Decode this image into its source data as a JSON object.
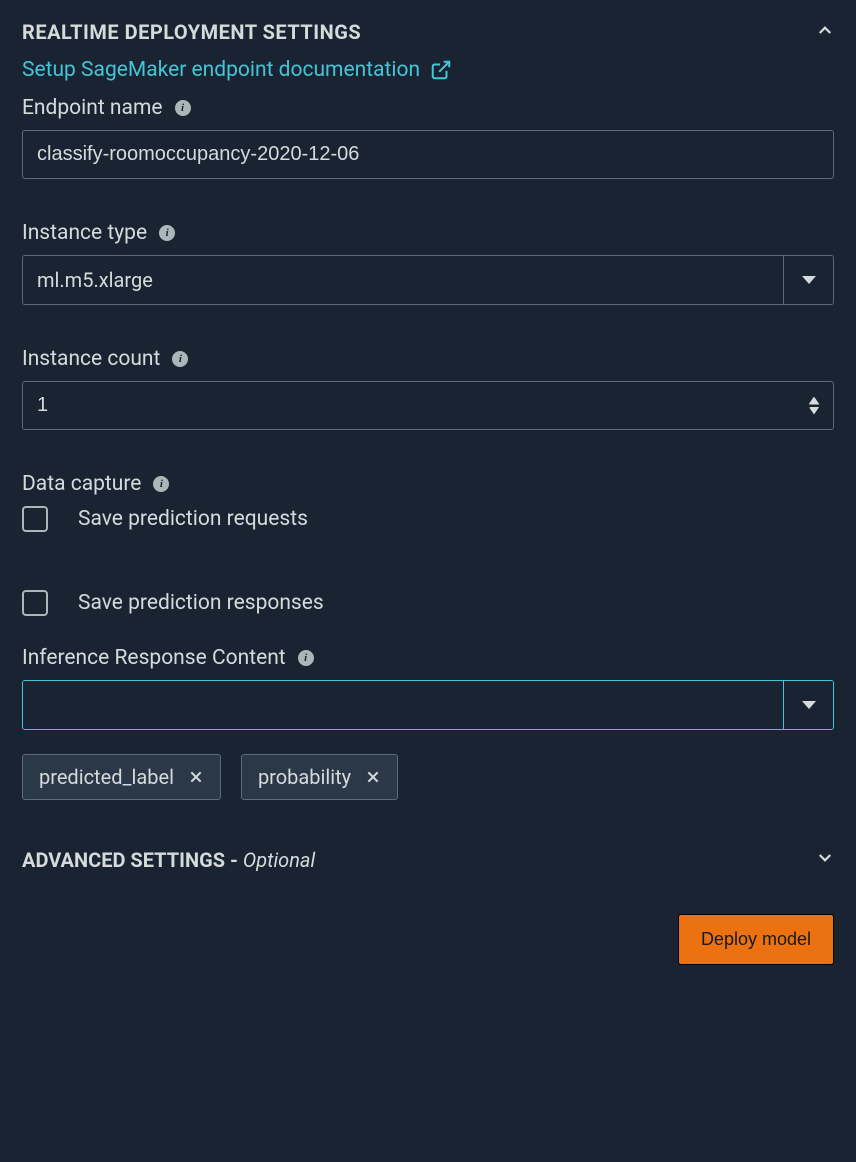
{
  "header": {
    "title": "REALTIME DEPLOYMENT SETTINGS"
  },
  "doc_link": {
    "text": "Setup SageMaker endpoint documentation"
  },
  "endpoint_name": {
    "label": "Endpoint name",
    "value": "classify-roomoccupancy-2020-12-06"
  },
  "instance_type": {
    "label": "Instance type",
    "value": "ml.m5.xlarge"
  },
  "instance_count": {
    "label": "Instance count",
    "value": "1"
  },
  "data_capture": {
    "label": "Data capture",
    "save_requests_label": "Save prediction requests",
    "save_responses_label": "Save prediction responses"
  },
  "inference_response": {
    "label": "Inference Response Content",
    "value": "",
    "chips": [
      {
        "label": "predicted_label"
      },
      {
        "label": "probability"
      }
    ]
  },
  "advanced": {
    "title_prefix": "ADVANCED SETTINGS - ",
    "title_suffix": "Optional"
  },
  "deploy": {
    "label": "Deploy model"
  }
}
